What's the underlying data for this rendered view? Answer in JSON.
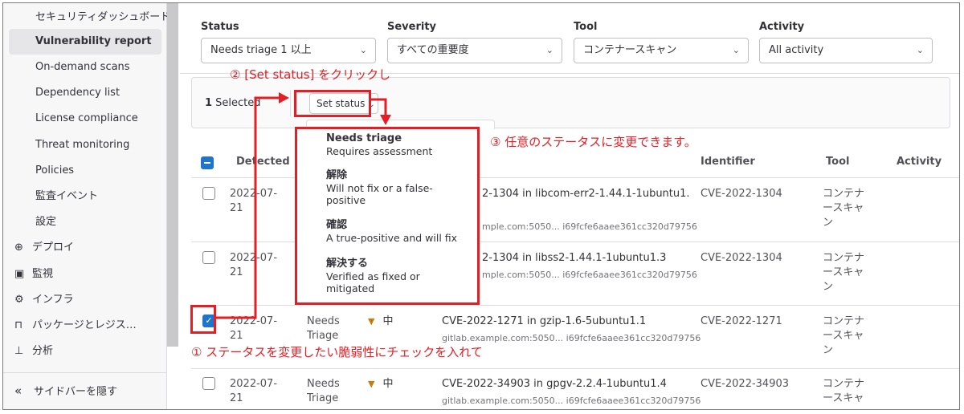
{
  "sidebar": {
    "items": [
      {
        "label": "セキュリティダッシュボード"
      },
      {
        "label": "Vulnerability report"
      },
      {
        "label": "On-demand scans"
      },
      {
        "label": "Dependency list"
      },
      {
        "label": "License compliance"
      },
      {
        "label": "Threat monitoring"
      },
      {
        "label": "Policies"
      },
      {
        "label": "監査イベント"
      },
      {
        "label": "設定"
      }
    ],
    "top_items": [
      {
        "label": "デプロイ",
        "icon": "rocket-icon",
        "glyph": "⊕"
      },
      {
        "label": "監視",
        "icon": "monitor-icon",
        "glyph": "▣"
      },
      {
        "label": "インフラ",
        "icon": "cloud-gear-icon",
        "glyph": "⚙"
      },
      {
        "label": "パッケージとレジス…",
        "icon": "package-icon",
        "glyph": "⊓"
      },
      {
        "label": "分析",
        "icon": "chart-icon",
        "glyph": "⊥"
      }
    ],
    "hide_label": "サイドバーを隠す",
    "hide_glyph": "«"
  },
  "filters": [
    {
      "label": "Status",
      "value": "Needs triage 1 以上"
    },
    {
      "label": "Severity",
      "value": "すべての重要度"
    },
    {
      "label": "Tool",
      "value": "コンテナースキャン"
    },
    {
      "label": "Activity",
      "value": "All activity"
    }
  ],
  "selection": {
    "count": "1",
    "count_suffix": " Selected",
    "set_status_label": "Set status"
  },
  "table": {
    "headers": {
      "detected": "Detected",
      "identifier": "Identifier",
      "tool": "Tool",
      "activity": "Activity"
    },
    "rows": [
      {
        "checked": false,
        "date1": "2022-07-",
        "date2": "21",
        "status1": "",
        "status2": "",
        "severity": "",
        "title": "2-1304 in libcom-err2-1.44.1-1ubuntu1.",
        "location": "mple.com:5050... i69fcfe6aaee361cc320d79756",
        "identifier": "CVE-2022-1304",
        "tool1": "コンテナ",
        "tool2": "ースキャ",
        "tool3": "ン"
      },
      {
        "checked": false,
        "date1": "2022-07-",
        "date2": "21",
        "status1": "",
        "status2": "",
        "severity": "",
        "title": "2-1304 in libss2-1.44.1-1ubuntu1.3",
        "location": "mple.com:5050... i69fcfe6aaee361cc320d79756",
        "identifier": "CVE-2022-1304",
        "tool1": "コンテナ",
        "tool2": "ースキャ",
        "tool3": "ン"
      },
      {
        "checked": true,
        "date1": "2022-07-",
        "date2": "21",
        "status1": "Needs",
        "status2": "Triage",
        "severity": "中",
        "title": "CVE-2022-1271 in gzip-1.6-5ubuntu1.1",
        "location": "gitlab.example.com:5050... i69fcfe6aaee361cc320d79756",
        "identifier": "CVE-2022-1271",
        "tool1": "コンテナ",
        "tool2": "ースキャ",
        "tool3": "ン"
      },
      {
        "checked": false,
        "date1": "2022-07-",
        "date2": "21",
        "status1": "Needs",
        "status2": "Triage",
        "severity": "中",
        "title": "CVE-2022-34903 in gpgv-2.2.4-1ubuntu1.4",
        "location": "gitlab.example.com:5050... i69fcfe6aaee361cc320d79756",
        "identifier": "CVE-2022-34903",
        "tool1": "コンテナ",
        "tool2": "ースキャ",
        "tool3": ""
      }
    ]
  },
  "dropdown": {
    "items": [
      {
        "title": "Needs triage",
        "desc1": "Requires assessment",
        "desc2": ""
      },
      {
        "title": "解除",
        "desc1": "Will not fix or a false-",
        "desc2": "positive"
      },
      {
        "title": "確認",
        "desc1": "A true-positive and will fix",
        "desc2": ""
      },
      {
        "title": "解決する",
        "desc1": "Verified as fixed or",
        "desc2": "mitigated"
      }
    ]
  },
  "annotations": {
    "step1": "① ステータスを変更したい脆弱性にチェックを入れて",
    "step2": "② [Set status] をクリックし",
    "step3": "③ 任意のステータスに変更できます。"
  },
  "colors": {
    "annotation_red": "#e31e24",
    "checkbox_blue": "#1f75cb",
    "severity_medium": "#c17d10"
  }
}
